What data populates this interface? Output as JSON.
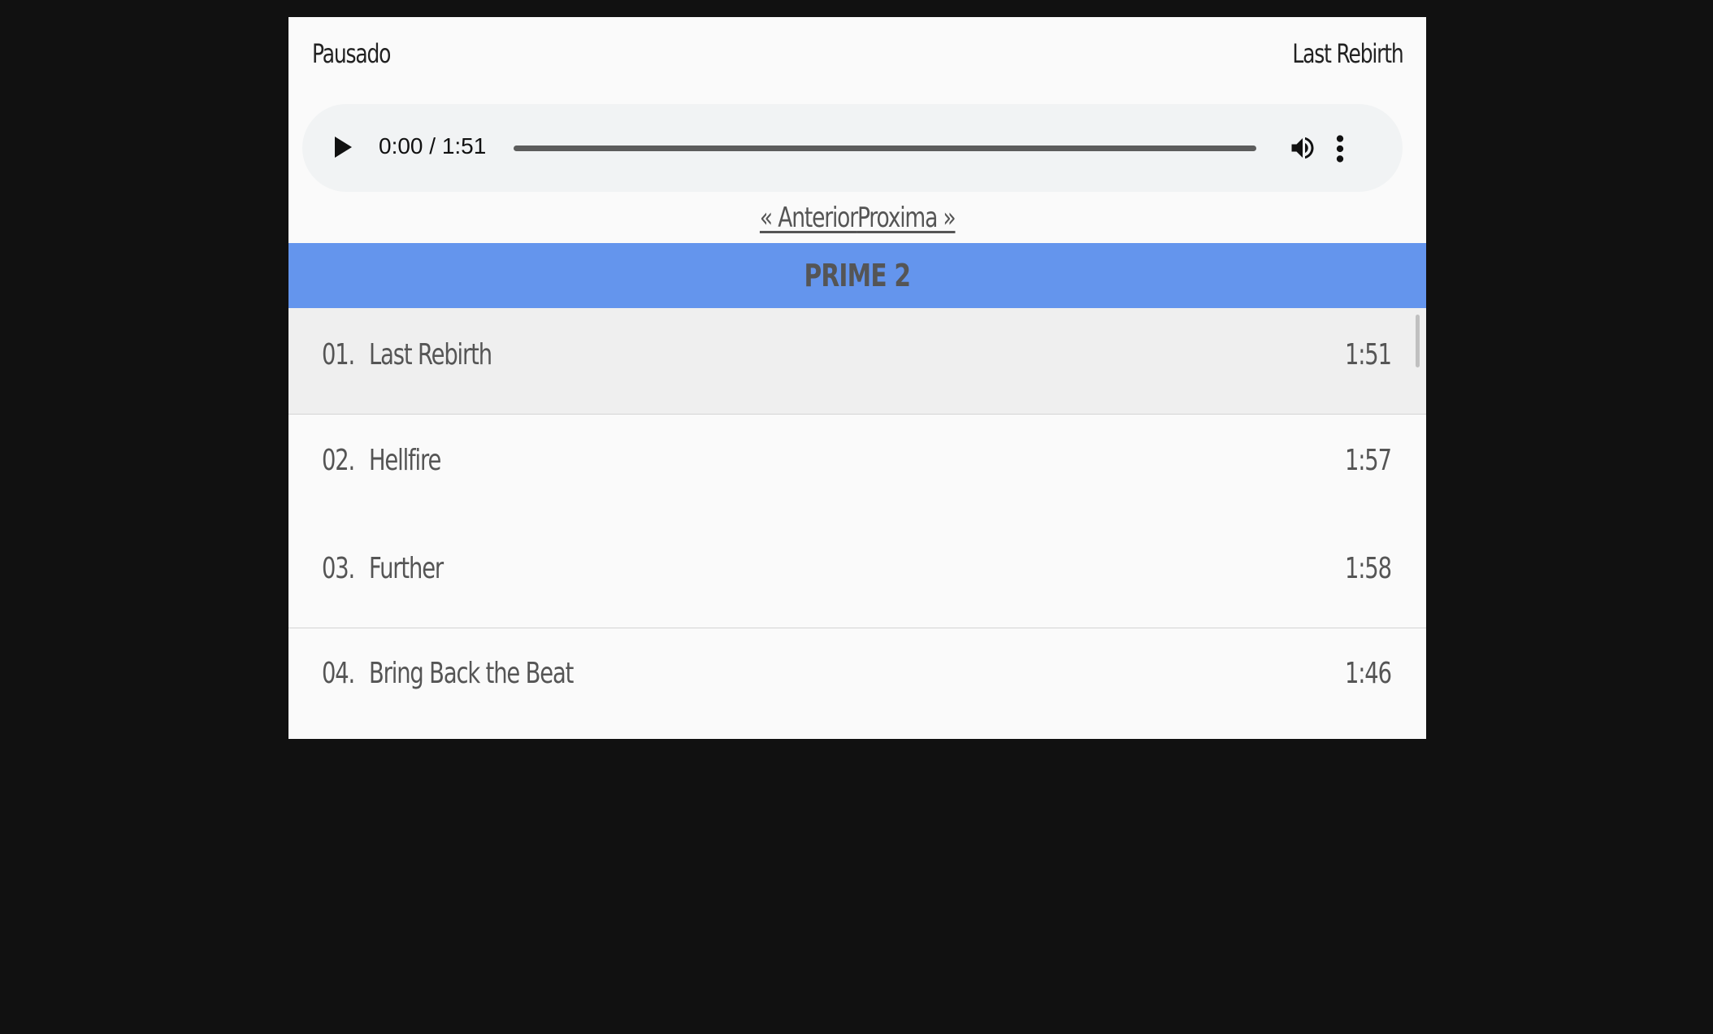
{
  "player": {
    "status": "Pausado",
    "now_playing": "Last Rebirth"
  },
  "audio": {
    "time": "0:00 / 1:51",
    "progress": 0,
    "icons": [
      "play-icon",
      "volume-icon",
      "more-vert-icon"
    ]
  },
  "nav": {
    "prev_label": "« Anterior",
    "next_label": "Proxima »"
  },
  "album": {
    "title": "PRIME 2",
    "accent_color": "#6495ed"
  },
  "tracks": [
    {
      "num": "01.",
      "title": "Last Rebirth",
      "duration": "1:51",
      "active": true
    },
    {
      "num": "02.",
      "title": "Hellfire",
      "duration": "1:57",
      "active": false
    },
    {
      "num": "03.",
      "title": "Further",
      "duration": "1:58",
      "active": false
    },
    {
      "num": "04.",
      "title": "Bring Back the Beat",
      "duration": "1:46",
      "active": false
    }
  ]
}
